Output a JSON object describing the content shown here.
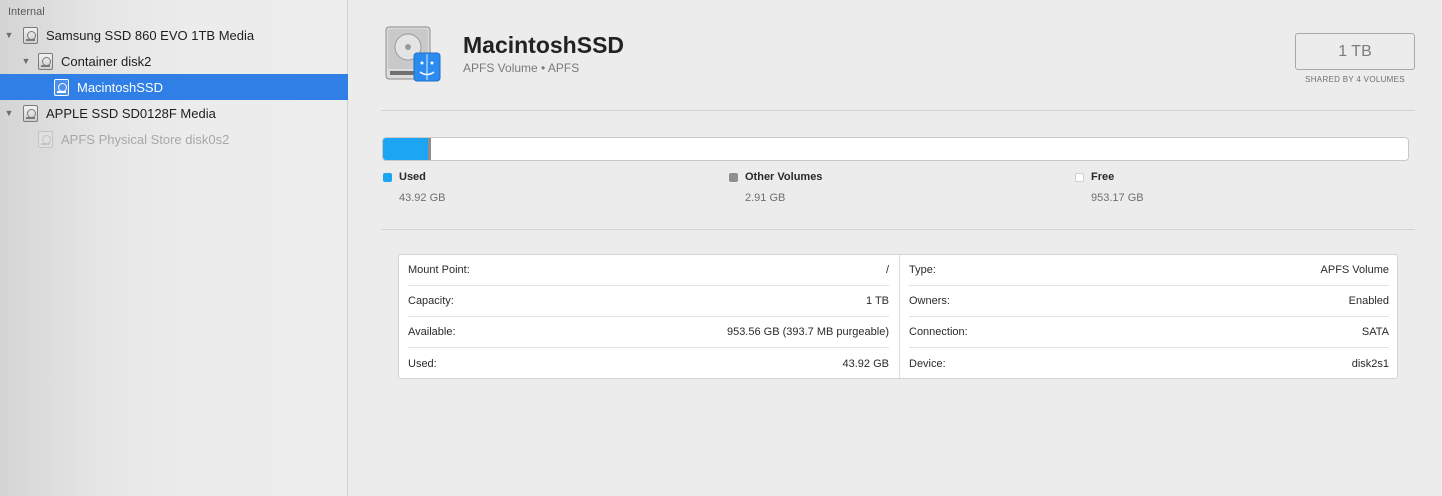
{
  "sidebar": {
    "section_label": "Internal",
    "items": [
      {
        "label": "Samsung SSD 860 EVO 1TB Media",
        "disclosure": "▼",
        "icon": "hard-disk-icon"
      },
      {
        "label": "Container disk2",
        "disclosure": "▼",
        "icon": "container-disk-icon"
      },
      {
        "label": "MacintoshSSD",
        "disclosure": "",
        "icon": "volume-disk-icon",
        "selected": true
      },
      {
        "label": "APPLE SSD SD0128F Media",
        "disclosure": "▼",
        "icon": "hard-disk-icon"
      },
      {
        "label": "APFS Physical Store disk0s2",
        "disclosure": "",
        "icon": "physical-store-icon",
        "dimmed": true
      }
    ]
  },
  "volume": {
    "name": "MacintoshSSD",
    "subtitle": "APFS Volume • APFS",
    "icon": "internal-drive-finder-icon",
    "capacity": "1 TB",
    "capacity_caption": "SHARED BY 4 VOLUMES"
  },
  "usage": {
    "used_fraction": 0.0439,
    "other_fraction": 0.0029,
    "used": {
      "label": "Used",
      "value": "43.92 GB",
      "color": "#1ca5f2"
    },
    "other": {
      "label": "Other Volumes",
      "value": "2.91 GB",
      "color": "#8f8f8f"
    },
    "free": {
      "label": "Free",
      "value": "953.17 GB",
      "color": "#ffffff"
    }
  },
  "info": {
    "left": [
      {
        "label": "Mount Point:",
        "value": "/"
      },
      {
        "label": "Capacity:",
        "value": "1 TB"
      },
      {
        "label": "Available:",
        "value": "953.56 GB (393.7 MB purgeable)"
      },
      {
        "label": "Used:",
        "value": "43.92 GB"
      }
    ],
    "right": [
      {
        "label": "Type:",
        "value": "APFS Volume"
      },
      {
        "label": "Owners:",
        "value": "Enabled"
      },
      {
        "label": "Connection:",
        "value": "SATA"
      },
      {
        "label": "Device:",
        "value": "disk2s1"
      }
    ]
  }
}
